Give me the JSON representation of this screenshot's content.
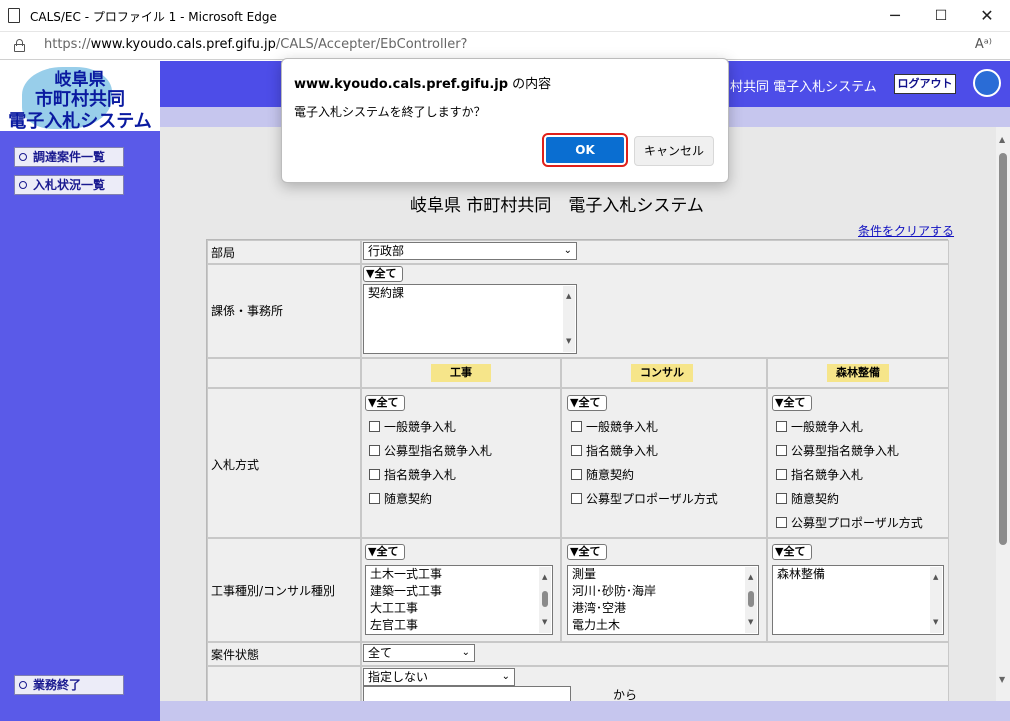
{
  "browser": {
    "window_title": "CALS/EC - プロファイル 1 - Microsoft Edge",
    "url_prefix": "https://",
    "url_host": "www.kyoudo.cals.pref.gifu.jp",
    "url_path": "/CALS/Accepter/EbController?",
    "read_aloud": "Aᵃ⁾",
    "min_glyph": "─",
    "max_glyph": "☐",
    "close_glyph": "✕"
  },
  "logo": {
    "line1": "岐阜県",
    "line2": "市町村共同",
    "line3": "電子入札システム"
  },
  "sidebar": {
    "items": [
      {
        "label": "調達案件一覧"
      },
      {
        "label": "入札状況一覧"
      }
    ],
    "end_button": "業務終了"
  },
  "header": {
    "system_name": "村共同 電子入札システム",
    "logout_label": "ログアウト"
  },
  "main": {
    "title": "岐阜県 市町村共同　電子入札システム",
    "clear_link": "条件をクリアする",
    "bureau": {
      "label": "部局",
      "value": "行政部"
    },
    "section": {
      "label": "課係・事務所",
      "all_button": "▼全て",
      "items": [
        "契約課"
      ]
    },
    "columns": [
      "工事",
      "コンサル",
      "森林整備"
    ],
    "bid_method": {
      "label": "入札方式",
      "construction": [
        "一般競争入札",
        "公募型指名競争入札",
        "指名競争入札",
        "随意契約"
      ],
      "consultant": [
        "一般競争入札",
        "指名競争入札",
        "随意契約",
        "公募型プロポーザル方式"
      ],
      "forestry": [
        "一般競争入札",
        "公募型指名競争入札",
        "指名競争入札",
        "随意契約",
        "公募型プロポーザル方式"
      ]
    },
    "work_type": {
      "label": "工事種別/コンサル種別",
      "construction": [
        "土木一式工事",
        "建築一式工事",
        "大工工事",
        "左官工事"
      ],
      "consultant": [
        "測量",
        "河川･砂防･海岸",
        "港湾･空港",
        "電力土木"
      ],
      "forestry": [
        "森林整備"
      ]
    },
    "case_status": {
      "label": "案件状態",
      "value": "全て"
    },
    "unspecified": {
      "value": "指定しない"
    },
    "to_label": "から"
  },
  "dialog": {
    "host": "www.kyoudo.cals.pref.gifu.jp",
    "title_suffix": " の内容",
    "message": "電子入札システムを終了しますか？",
    "ok_label": "OK",
    "cancel_label": "キャンセル"
  }
}
